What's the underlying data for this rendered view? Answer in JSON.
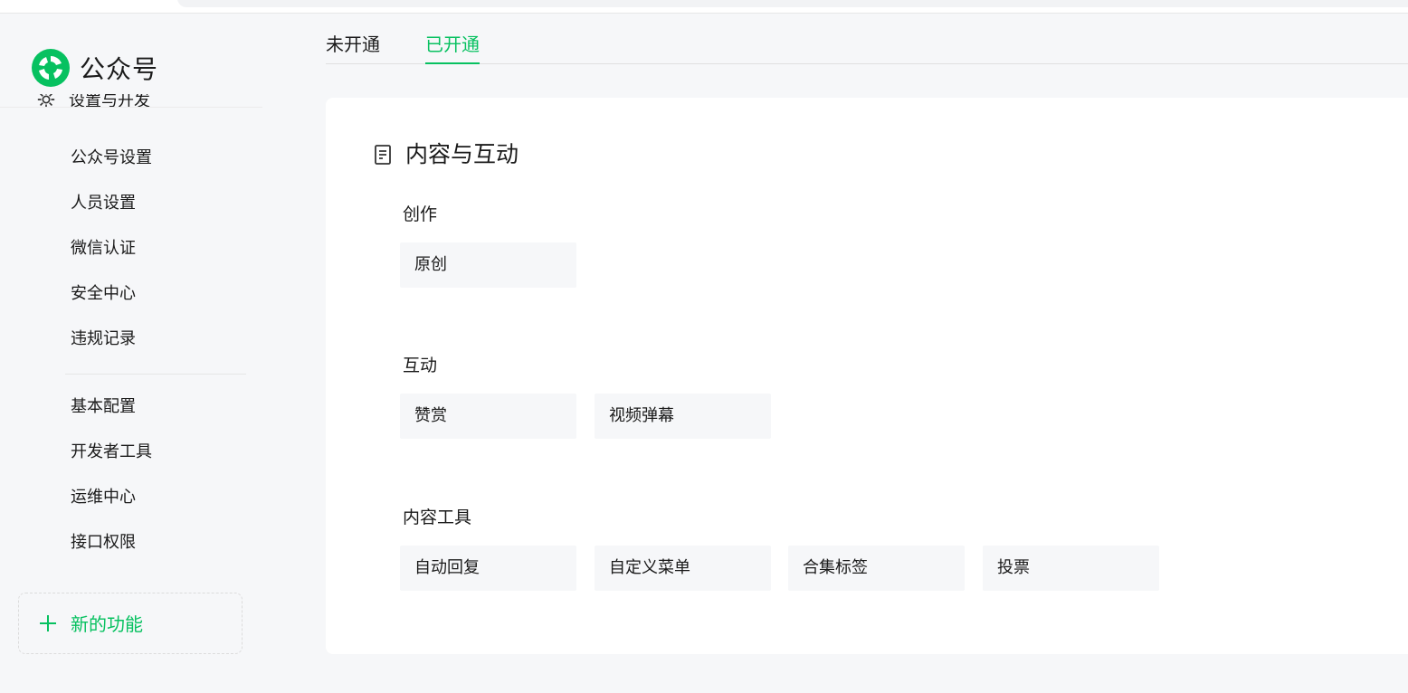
{
  "brand": {
    "name": "公众号",
    "accent_color": "#07c160",
    "logo_icon": "wechat-official-account-logo-icon"
  },
  "sidebar": {
    "section_header": "设置与开发",
    "section_icon": "gear-icon",
    "items": [
      {
        "label": "公众号设置"
      },
      {
        "label": "人员设置"
      },
      {
        "label": "微信认证"
      },
      {
        "label": "安全中心"
      },
      {
        "label": "违规记录"
      },
      {
        "label": "基本配置"
      },
      {
        "label": "开发者工具"
      },
      {
        "label": "运维中心"
      },
      {
        "label": "接口权限"
      }
    ],
    "new_feature": {
      "label": "新的功能",
      "icon": "plus-icon"
    }
  },
  "tabs": [
    {
      "label": "未开通",
      "active": false
    },
    {
      "label": "已开通",
      "active": true
    }
  ],
  "main": {
    "card_title": "内容与互动",
    "card_icon": "document-icon",
    "sections": [
      {
        "title": "创作",
        "features": [
          "原创"
        ]
      },
      {
        "title": "互动",
        "features": [
          "赞赏",
          "视频弹幕"
        ]
      },
      {
        "title": "内容工具",
        "features": [
          "自动回复",
          "自定义菜单",
          "合集标签",
          "投票"
        ]
      }
    ]
  }
}
